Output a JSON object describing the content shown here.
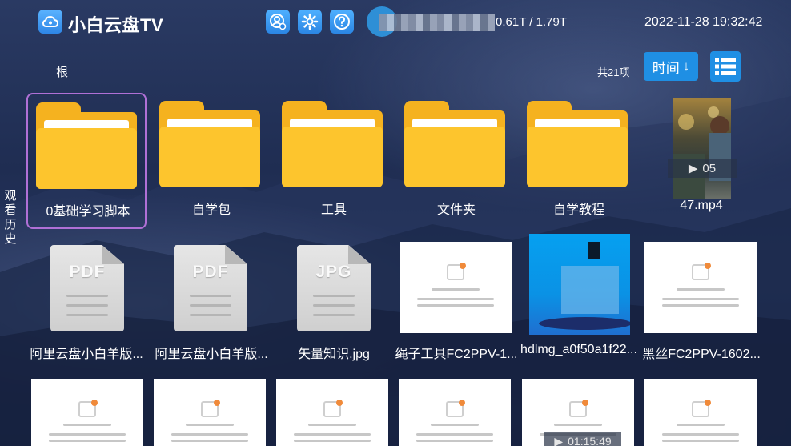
{
  "header": {
    "app_title": "小白云盘TV",
    "storage": "0.61T / 1.79T",
    "datetime": "2022-11-28 19:32:42"
  },
  "toolbar": {
    "breadcrumb": "根",
    "item_count": "共21项",
    "sort_label": "时间",
    "sort_arrow": "↓"
  },
  "side": {
    "history_label": "观看历史"
  },
  "files": {
    "row1": [
      "0基础学习脚本",
      "自学包",
      "工具",
      "文件夹",
      "自学教程",
      "47.mp4"
    ],
    "row2": [
      "阿里云盘小白羊版...",
      "阿里云盘小白羊版...",
      "矢量知识.jpg",
      "绳子工具FC2PPV-1...",
      "hdlmg_a0f50a1f22...",
      "黑丝FC2PPV-1602..."
    ],
    "doc_ext": [
      "PDF",
      "PDF",
      "JPG"
    ]
  },
  "video": {
    "duration_1": "05",
    "duration_2": "01:15:49"
  },
  "colors": {
    "accent": "#1f8fe4",
    "folder": "#fdc52d",
    "selected_border": "#b070d6"
  }
}
